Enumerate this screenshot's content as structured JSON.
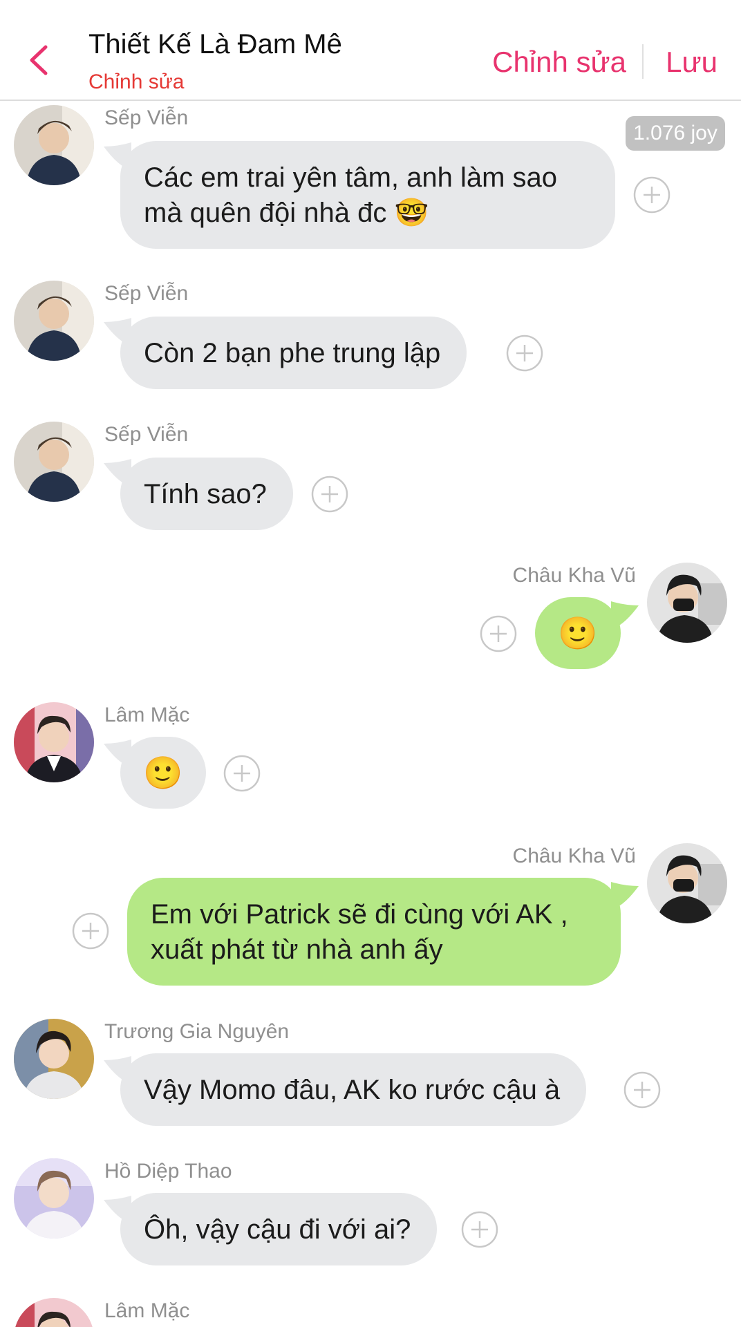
{
  "header": {
    "back_icon": "chevron-left-icon",
    "title": "Thiết Kế Là Đam Mê",
    "subtitle": "Chỉnh sửa",
    "edit_label": "Chỉnh sửa",
    "save_label": "Lưu",
    "accent_color": "#e8336e"
  },
  "badge": {
    "text": "1.076 joy"
  },
  "messages": [
    {
      "sender": "Sếp Viễn",
      "lines": [
        "Các em trai yên tâm, anh làm sao",
        "mà quên đội nhà đc 🤓"
      ],
      "side": "in"
    },
    {
      "sender": "Sếp Viễn",
      "lines": [
        "Còn 2 bạn phe trung lập"
      ],
      "side": "in"
    },
    {
      "sender": "Sếp Viễn",
      "lines": [
        "Tính sao?"
      ],
      "side": "in"
    },
    {
      "sender": "Châu Kha Vũ",
      "lines": [
        "🙂"
      ],
      "side": "out"
    },
    {
      "sender": "Lâm Mặc",
      "lines": [
        "🙂"
      ],
      "side": "in"
    },
    {
      "sender": "Châu Kha Vũ",
      "lines": [
        "Em với Patrick sẽ đi cùng với AK ,",
        "xuất phát từ nhà anh ấy"
      ],
      "side": "out"
    },
    {
      "sender": "Trương Gia Nguyên",
      "lines": [
        "Vậy Momo đâu, AK ko rước cậu à"
      ],
      "side": "in"
    },
    {
      "sender": "Hồ Diệp Thao",
      "lines": [
        "Ôh, vậy cậu đi với ai?"
      ],
      "side": "in"
    },
    {
      "sender": "Lâm Mặc",
      "lines": [],
      "side": "in"
    }
  ],
  "colors": {
    "incoming_bubble": "#e7e8ea",
    "outgoing_bubble": "#b5e886",
    "sender_text": "#8f8f8f"
  }
}
